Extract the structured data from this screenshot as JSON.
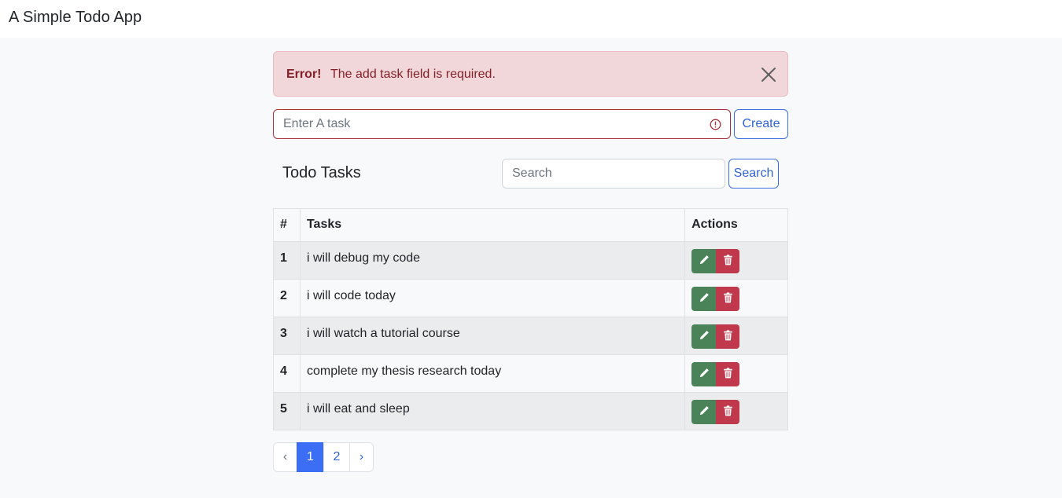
{
  "navbar": {
    "brand": "A Simple Todo App"
  },
  "alert": {
    "strong": "Error!",
    "message": "The add task field is required."
  },
  "create_form": {
    "placeholder": "Enter A task",
    "value": "",
    "button_label": "Create"
  },
  "tasks_section": {
    "title": "Todo Tasks",
    "search_placeholder": "Search",
    "search_button_label": "Search"
  },
  "table": {
    "headers": [
      "#",
      "Tasks",
      "Actions"
    ],
    "rows": [
      {
        "num": "1",
        "task": "i will debug my code"
      },
      {
        "num": "2",
        "task": "i will code today"
      },
      {
        "num": "3",
        "task": "i will watch a tutorial course"
      },
      {
        "num": "4",
        "task": "complete my thesis research today"
      },
      {
        "num": "5",
        "task": "i will eat and sleep"
      }
    ]
  },
  "pagination": {
    "prev": "‹",
    "pages": [
      "1",
      "2"
    ],
    "next": "›",
    "current": "1"
  },
  "icons": {
    "close": "close-icon",
    "invalid": "exclamation-circle-icon",
    "edit": "pencil-icon",
    "delete": "trash-icon"
  },
  "colors": {
    "danger_text": "#842029",
    "alert_bg": "#f1d7d9",
    "primary": "#3b6ef5",
    "success": "#4a8357",
    "danger": "#c0384b"
  }
}
